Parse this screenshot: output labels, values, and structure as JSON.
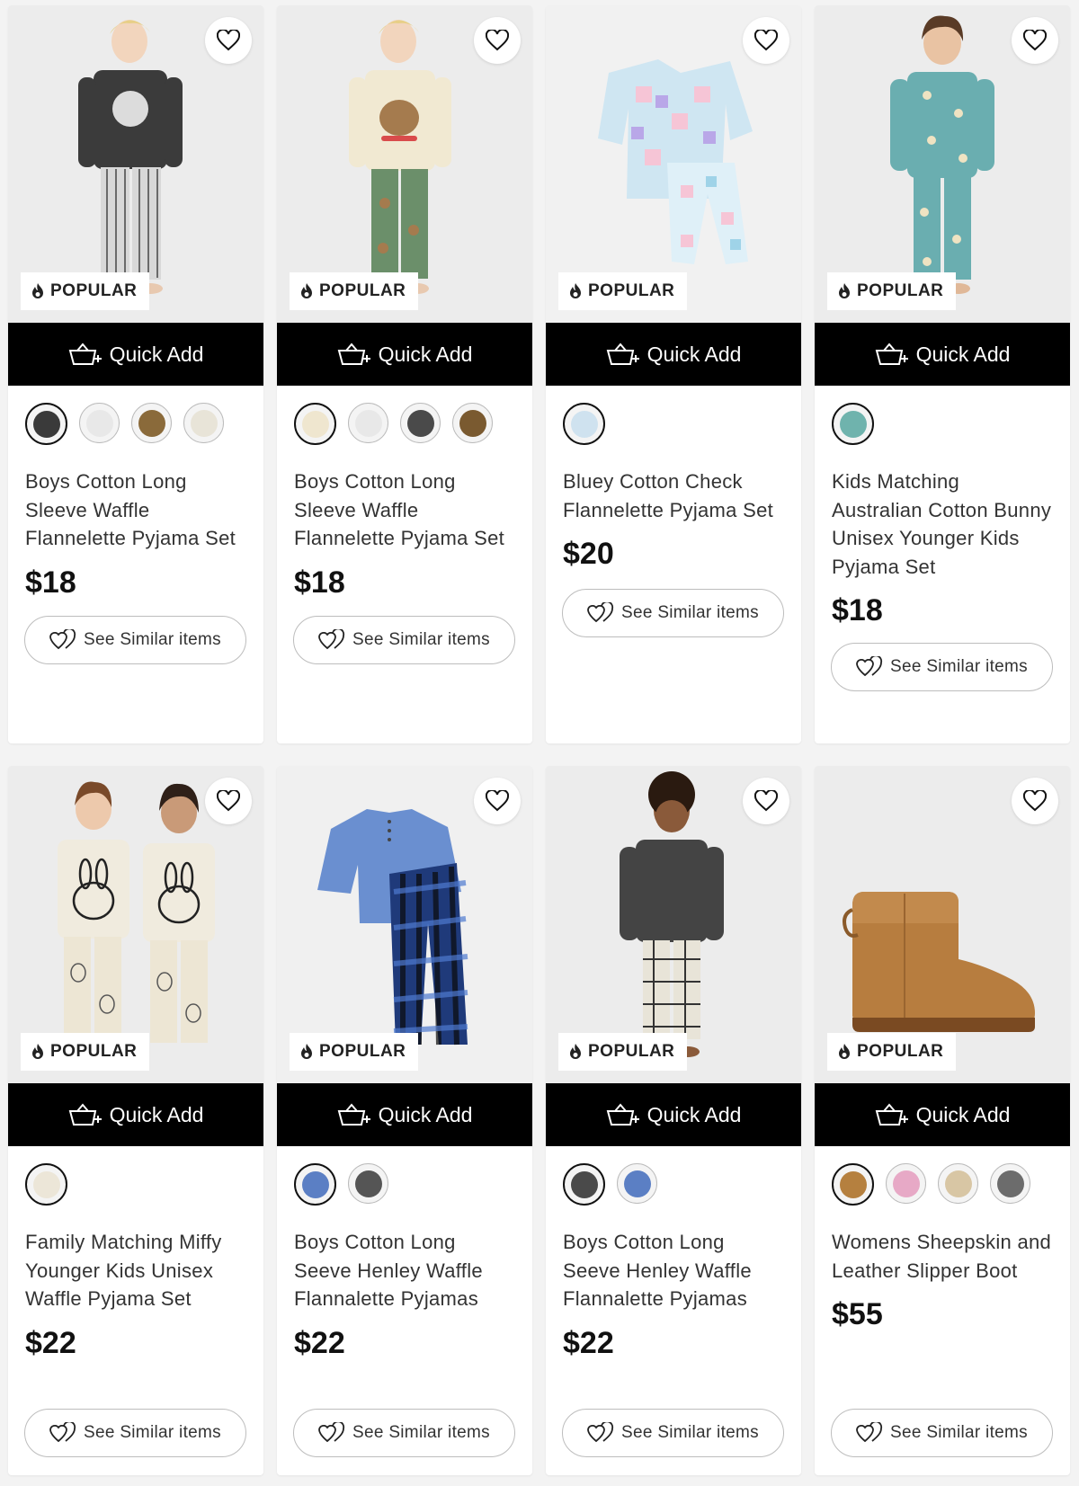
{
  "products": [
    {
      "badge": "POPULAR",
      "quick_add": "Quick Add",
      "title": "Boys Cotton Long Sleeve Waffle Flannelette Pyjama Set",
      "price": "$18",
      "similar": "See Similar items",
      "swatches": [
        "#3a3a3a",
        "#e8e8e8",
        "#8a6a3a",
        "#e8e4d8"
      ]
    },
    {
      "badge": "POPULAR",
      "quick_add": "Quick Add",
      "title": "Boys Cotton Long Sleeve Waffle Flannelette Pyjama Set",
      "price": "$18",
      "similar": "See Similar items",
      "swatches": [
        "#efe6cf",
        "#e8e8e8",
        "#4a4a4a",
        "#7a5a30"
      ]
    },
    {
      "badge": "POPULAR",
      "quick_add": "Quick Add",
      "title": "Bluey Cotton Check Flannelette Pyjama Set",
      "price": "$20",
      "similar": "See Similar items",
      "swatches": [
        "#cfe2ef"
      ]
    },
    {
      "badge": "POPULAR",
      "quick_add": "Quick Add",
      "title": "Kids Matching Australian Cotton Bunny Unisex Younger Kids Pyjama Set",
      "price": "$18",
      "similar": "See Similar items",
      "swatches": [
        "#6fb3ad"
      ]
    },
    {
      "badge": "POPULAR",
      "quick_add": "Quick Add",
      "title": "Family Matching Miffy Younger Kids Unisex Waffle Pyjama Set",
      "price": "$22",
      "similar": "See Similar items",
      "swatches": [
        "#ece6d8"
      ]
    },
    {
      "badge": "POPULAR",
      "quick_add": "Quick Add",
      "title": "Boys Cotton Long Seeve Henley Waffle Flannalette Pyjamas",
      "price": "$22",
      "similar": "See Similar items",
      "swatches": [
        "#5b7fc4",
        "#555555"
      ]
    },
    {
      "badge": "POPULAR",
      "quick_add": "Quick Add",
      "title": "Boys Cotton Long Seeve Henley Waffle Flannalette Pyjamas",
      "price": "$22",
      "similar": "See Similar items",
      "swatches": [
        "#4a4a4a",
        "#5b7fc4"
      ]
    },
    {
      "badge": "POPULAR",
      "quick_add": "Quick Add",
      "title": "Womens Sheepskin and Leather Slipper Boot",
      "price": "$55",
      "similar": "See Similar items",
      "swatches": [
        "#b5803f",
        "#e7a9c6",
        "#d8c6a4",
        "#6c6c6c"
      ]
    }
  ]
}
